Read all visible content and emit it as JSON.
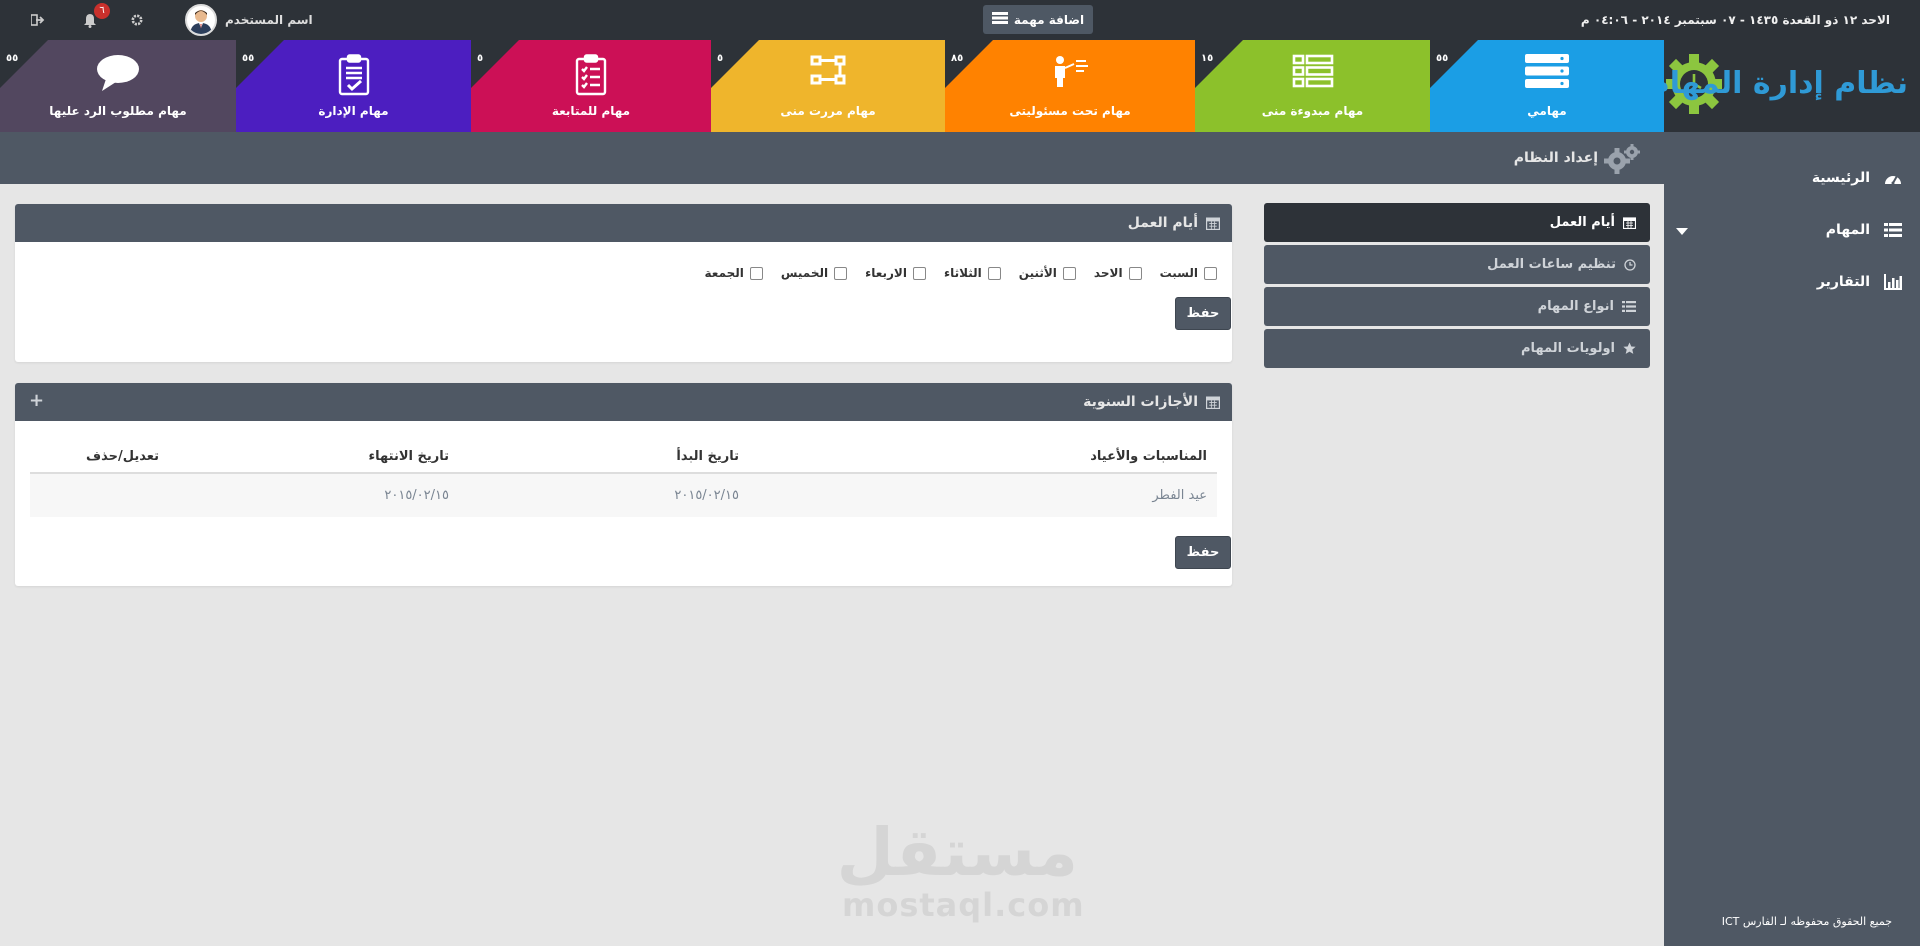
{
  "topbar": {
    "date_text": "الاحد ١٢ ذو القعدة ١٤٣٥ - ٠٧ سبتمبر ٢٠١٤ - ٠٤:٠٦ م",
    "add_task_label": "اضافة مهمة",
    "user_name": "اسم المستخدم",
    "notification_count": "٦"
  },
  "brand": {
    "logo_text": "نظام إدارة المهام",
    "accent": "#2f9ad6",
    "gear_color": "#8cc63f"
  },
  "sidebar": {
    "items": [
      {
        "label": "الرئيسية",
        "icon": "dashboard-icon"
      },
      {
        "label": "المهام",
        "icon": "list-icon"
      },
      {
        "label": "التقارير",
        "icon": "bar-chart-icon"
      }
    ],
    "footer": "جميع الحقوق محفوظه لـ الفارس ICT"
  },
  "tiles": [
    {
      "label": "مهامي",
      "count": "٥٥",
      "color": "#1b9ee5",
      "icon": "stack-icon"
    },
    {
      "label": "مهام مبدوءة منى",
      "count": "١٥",
      "color": "#8cc12b",
      "icon": "list-icon"
    },
    {
      "label": "مهام تحت مسئوليتى",
      "count": "٨٥",
      "color": "#ff8200",
      "icon": "presenter-icon"
    },
    {
      "label": "مهام مررت منى",
      "count": "٥",
      "color": "#efb52c",
      "icon": "flow-icon"
    },
    {
      "label": "مهام للمتابعة",
      "count": "٥",
      "color": "#cc1056",
      "icon": "checklist-icon"
    },
    {
      "label": "مهام الإدارة",
      "count": "٥٥",
      "color": "#4c1ec0",
      "icon": "clipboard-icon"
    },
    {
      "label": "مهام مطلوب الرد عليها",
      "count": "٥٥",
      "color": "#52475f",
      "icon": "chat-icon"
    }
  ],
  "page": {
    "title": "إعداد النظام"
  },
  "settings_menu": [
    {
      "label": "أيام العمل",
      "icon": "calendar-icon",
      "active": true
    },
    {
      "label": "تنظيم ساعات العمل",
      "icon": "clock-icon",
      "active": false
    },
    {
      "label": "انواع المهام",
      "icon": "list-icon",
      "active": false
    },
    {
      "label": "اولويات المهام",
      "icon": "star-icon",
      "active": false
    }
  ],
  "work_days": {
    "title": "أيام العمل",
    "days": [
      "السبت",
      "الاحد",
      "الأثنين",
      "الثلاثاء",
      "الاربعاء",
      "الخميس",
      "الجمعة"
    ],
    "save_label": "حفظ"
  },
  "holidays": {
    "title": "الأجازات السنوية",
    "add_symbol": "+",
    "columns": [
      "المناسبات والأعياد",
      "تاريخ البدأ",
      "تاريخ الانتهاء",
      "تعديل/حذف"
    ],
    "rows": [
      [
        "عيد الفطر",
        "٢٠١٥/٠٢/١٥",
        "٢٠١٥/٠٢/١٥",
        ""
      ]
    ],
    "save_label": "حفظ"
  },
  "watermark": {
    "arabic": "مستقل",
    "latin": "mostaql.com"
  }
}
